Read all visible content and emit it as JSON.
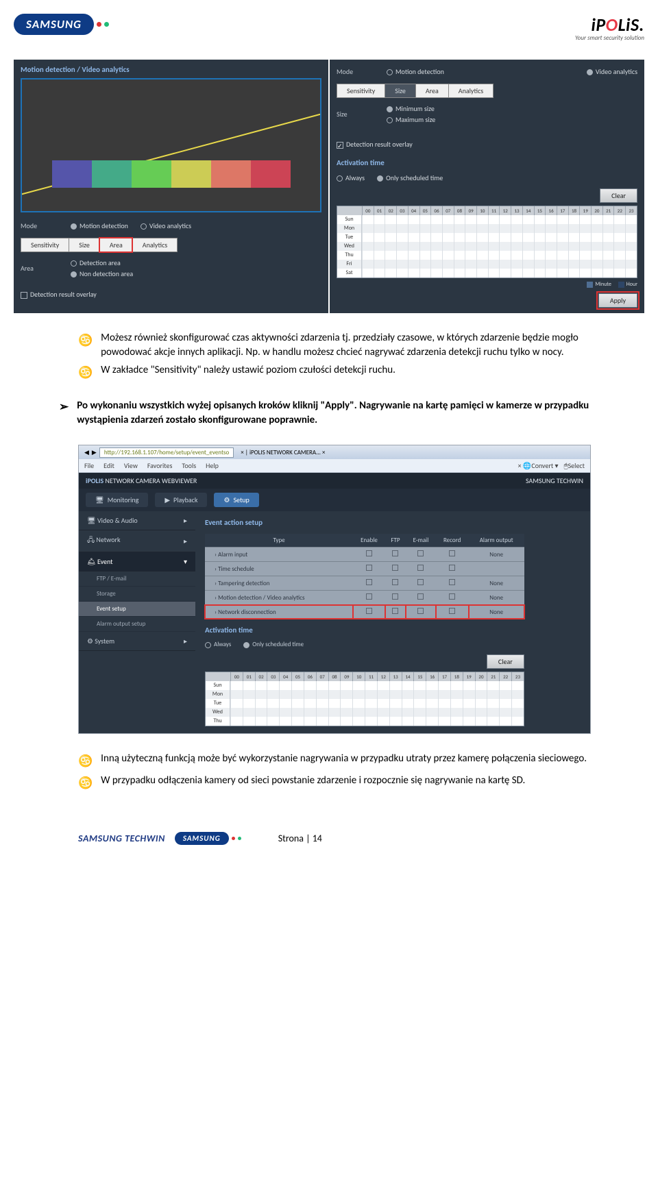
{
  "header": {
    "brand_left": "SAMSUNG",
    "brand_right_prefix": "iP",
    "brand_right_mid": "O",
    "brand_right_suffix": "LiS.",
    "brand_right_tag": "Your smart security solution"
  },
  "shot1_left": {
    "title": "Motion detection / Video analytics",
    "mode_label": "Mode",
    "mode_opt1": "Motion detection",
    "mode_opt2": "Video analytics",
    "tabs": [
      "Sensitivity",
      "Size",
      "Area",
      "Analytics"
    ],
    "area_label": "Area",
    "area_opt1": "Detection area",
    "area_opt2": "Non detection area",
    "overlay_label": "Detection result overlay"
  },
  "shot1_right": {
    "mode_label": "Mode",
    "mode_opt1": "Motion detection",
    "mode_opt2": "Video analytics",
    "tabs": [
      "Sensitivity",
      "Size",
      "Area",
      "Analytics"
    ],
    "size_label": "Size",
    "size_opt1": "Minimum size",
    "size_opt2": "Maximum size",
    "overlay_label": "Detection result overlay",
    "activation_label": "Activation time",
    "act_opt1": "Always",
    "act_opt2": "Only scheduled time",
    "clear_btn": "Clear",
    "hours": [
      "00",
      "01",
      "02",
      "03",
      "04",
      "05",
      "06",
      "07",
      "08",
      "09",
      "10",
      "11",
      "12",
      "13",
      "14",
      "15",
      "16",
      "17",
      "18",
      "19",
      "20",
      "21",
      "22",
      "23"
    ],
    "days": [
      "Sun",
      "Mon",
      "Tue",
      "Wed",
      "Thu",
      "Fri",
      "Sat"
    ],
    "legend_minute": "Minute",
    "legend_hour": "Hour",
    "apply_btn": "Apply"
  },
  "body": {
    "bullet1": "Możesz również skonfigurować czas aktywności zdarzenia tj. przedziały czasowe, w których zdarzenie będzie mogło powodować akcje innych aplikacji. Np. w handlu możesz chcieć nagrywać zdarzenia detekcji ruchu tylko w nocy.",
    "bullet2": "W zakładce \"Sensitivity\" należy ustawić poziom czułości detekcji ruchu.",
    "arrow_text": "Po wykonaniu wszystkich wyżej opisanych kroków kliknij \"Apply\". Nagrywanie na kartę pamięci w kamerze w przypadku wystąpienia zdarzeń zostało skonfigurowane poprawnie.",
    "bullet3": "Inną użyteczną funkcją może być wykorzystanie nagrywania w przypadku utraty przez kamerę połączenia sieciowego.",
    "bullet4": "W przypadku odłączenia kamery od sieci powstanie zdarzenie i rozpocznie się nagrywanie na kartę SD."
  },
  "shot2": {
    "url": "http://192.168.1.107/home/setup/event_eventso",
    "tab_title": "iPOLIS NETWORK CAMERA...",
    "menu": [
      "File",
      "Edit",
      "View",
      "Favorites",
      "Tools",
      "Help"
    ],
    "convert": "Convert",
    "select": "Select",
    "app_title_prefix": "iPOLIS",
    "app_title_rest": " NETWORK CAMERA WEBVIEWER",
    "vendor": "SAMSUNG TECHWIN",
    "nav_monitoring": "Monitoring",
    "nav_playback": "Playback",
    "nav_setup": "Setup",
    "side": {
      "video": "Video & Audio",
      "network": "Network",
      "event": "Event",
      "ftp": "FTP / E-mail",
      "storage": "Storage",
      "event_setup": "Event setup",
      "alarm_out": "Alarm output setup",
      "system": "System"
    },
    "panel_title": "Event action setup",
    "cols": [
      "Type",
      "Enable",
      "FTP",
      "E-mail",
      "Record",
      "Alarm output"
    ],
    "rows": [
      {
        "type": "Alarm input",
        "alarm": "None"
      },
      {
        "type": "Time schedule",
        "alarm": ""
      },
      {
        "type": "Tampering detection",
        "alarm": "None"
      },
      {
        "type": "Motion detection / Video analytics",
        "alarm": "None"
      },
      {
        "type": "Network disconnection",
        "alarm": "None"
      }
    ],
    "activation_label": "Activation time",
    "act_opt1": "Always",
    "act_opt2": "Only scheduled time",
    "clear_btn": "Clear",
    "hours": [
      "00",
      "01",
      "02",
      "03",
      "04",
      "05",
      "06",
      "07",
      "08",
      "09",
      "10",
      "11",
      "12",
      "13",
      "14",
      "15",
      "16",
      "17",
      "18",
      "19",
      "20",
      "21",
      "22",
      "23"
    ],
    "days": [
      "Sun",
      "Mon",
      "Tue",
      "Wed",
      "Thu"
    ]
  },
  "footer": {
    "techwin": "SAMSUNG TECHWIN",
    "brand": "SAMSUNG",
    "page_label": "Strona | 14"
  }
}
